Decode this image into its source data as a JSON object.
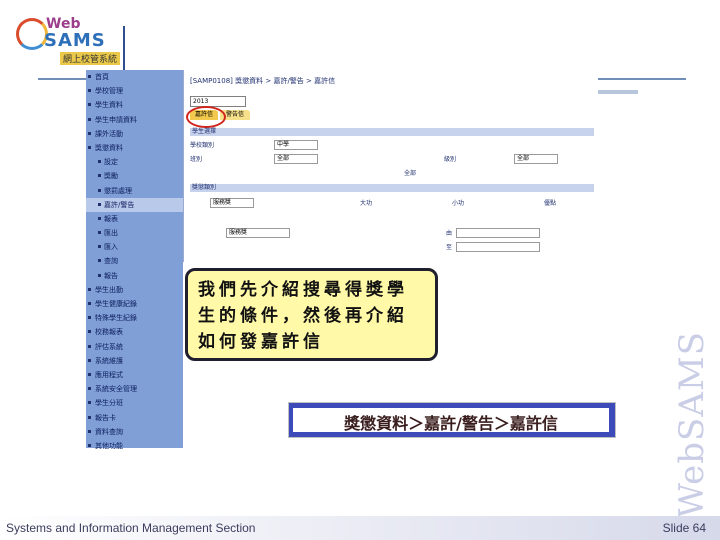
{
  "logo": {
    "web": "Web",
    "sams": "SAMS",
    "sub": "網上校管系統"
  },
  "nav": {
    "items": [
      {
        "label": "首頁",
        "sub": false
      },
      {
        "label": "學校管理",
        "sub": false
      },
      {
        "label": "學生資料",
        "sub": false
      },
      {
        "label": "學生申請資料",
        "sub": false
      },
      {
        "label": "課外活動",
        "sub": false
      },
      {
        "label": "獎懲資料",
        "sub": false
      },
      {
        "label": "設定",
        "sub": true
      },
      {
        "label": "獎勵",
        "sub": true
      },
      {
        "label": "懲罰處理",
        "sub": true
      },
      {
        "label": "嘉許/警告",
        "sub": true,
        "selected": true
      },
      {
        "label": "報表",
        "sub": true
      },
      {
        "label": "匯出",
        "sub": true
      },
      {
        "label": "匯入",
        "sub": true
      },
      {
        "label": "查詢",
        "sub": true
      },
      {
        "label": "報告",
        "sub": true
      },
      {
        "label": "學生出勤",
        "sub": false
      },
      {
        "label": "學生健康紀錄",
        "sub": false
      },
      {
        "label": "特殊學生紀錄",
        "sub": false
      },
      {
        "label": "校務報表",
        "sub": false
      },
      {
        "label": "評估系統",
        "sub": false
      },
      {
        "label": "系統維護",
        "sub": false
      },
      {
        "label": "應用程式",
        "sub": false
      },
      {
        "label": "系統安全管理",
        "sub": false
      },
      {
        "label": "學生分班",
        "sub": false
      },
      {
        "label": "報告卡",
        "sub": false
      },
      {
        "label": "資料查詢",
        "sub": false
      },
      {
        "label": "其他功能",
        "sub": false
      }
    ]
  },
  "panel": {
    "title": "[SAMP0108] 獎懲資料 > 嘉許/警告 > 嘉許信",
    "year": "2013",
    "tab_main": "嘉許信",
    "tab_other": "警告信",
    "row_school": "學校類別",
    "row_school_val": "中學",
    "row_class": "班別",
    "row_class_val": "全部",
    "row_level": "級別",
    "row_level_val": "全部",
    "section1": "學生選擇",
    "section2": "獎懲類別",
    "radio_all": "全部",
    "label_from": "由",
    "label_to": "至",
    "sel_award": "服務獎",
    "merit": "大功",
    "minor": "小功",
    "praise": "優點"
  },
  "callout": "我們先介紹搜尋得獎學生的條件，然後再介紹如何發嘉許信",
  "path": "獎懲資料＞嘉許/警告＞嘉許信",
  "watermark": "WebSAMS",
  "footer": {
    "left": "Systems and Information Management Section",
    "right": "Slide 64"
  }
}
